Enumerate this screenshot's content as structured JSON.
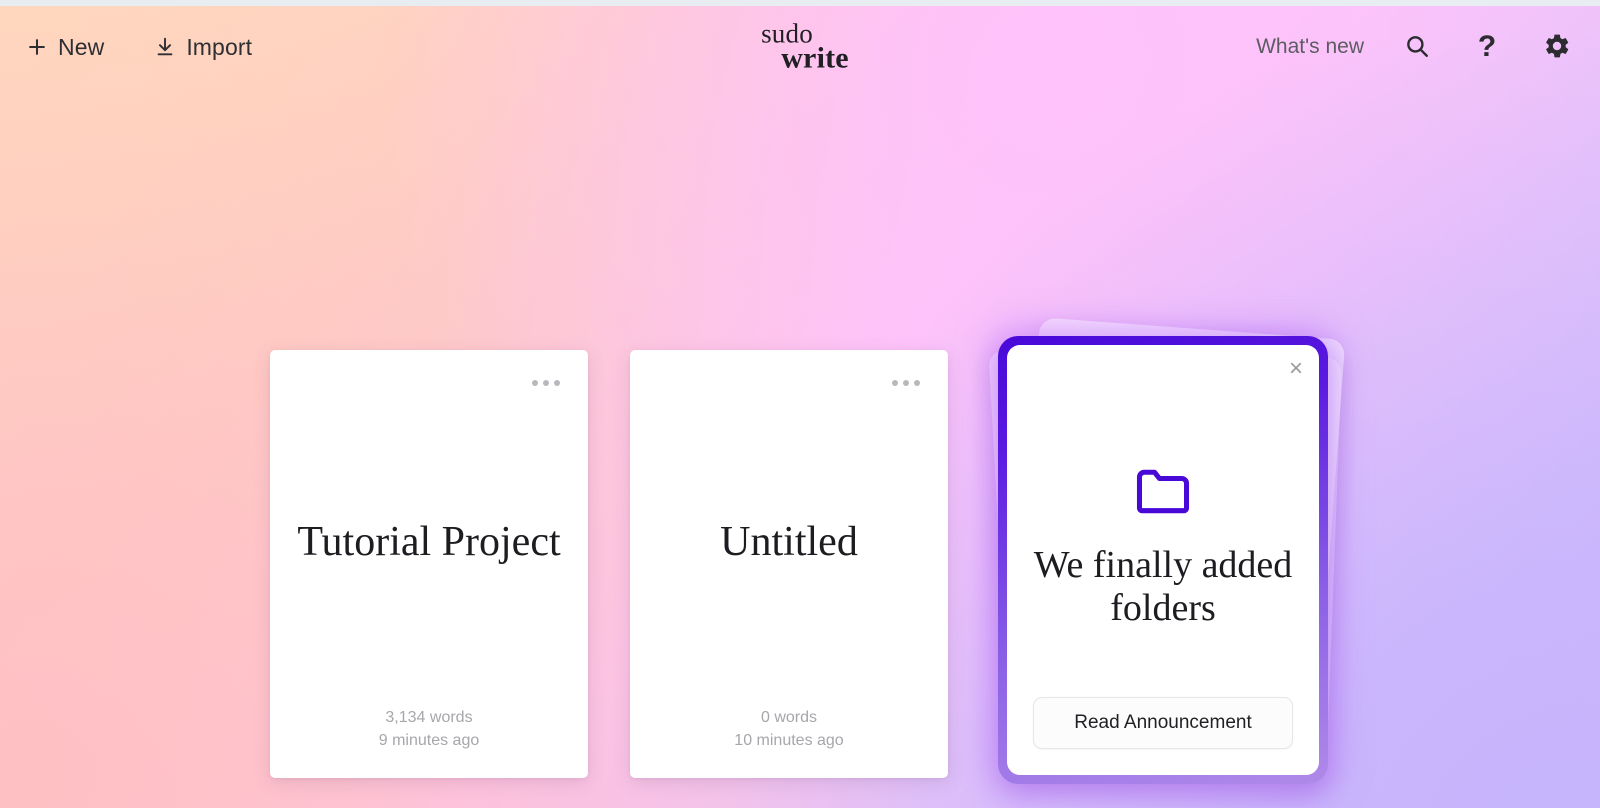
{
  "app": {
    "logo_line1": "sudo",
    "logo_line2": "write",
    "background_colors": {
      "top_left": "#fdd9bb",
      "bottom_left": "#ffc0c4",
      "top_right": "#fcc5f8",
      "bottom_right": "#c9b6fb",
      "center_pink": "#ffc2fb"
    }
  },
  "header": {
    "new_label": "New",
    "import_label": "Import",
    "whats_new_label": "What's new",
    "new_icon": "plus-icon",
    "import_icon": "download-icon",
    "search_icon": "search-icon",
    "help_icon": "question-mark-icon",
    "settings_icon": "gear-icon"
  },
  "projects": [
    {
      "title": "Tutorial Project",
      "words": "3,134 words",
      "modified": "9 minutes ago",
      "menu_icon": "more-options-icon"
    },
    {
      "title": "Untitled",
      "words": "0 words",
      "modified": "10 minutes ago",
      "menu_icon": "more-options-icon"
    }
  ],
  "announcement": {
    "title": "We finally added folders",
    "button_label": "Read Announcement",
    "close_icon": "close-icon",
    "feature_icon": "folder-icon",
    "accent_color": "#4808d8",
    "border_gradient_start": "#4808d8",
    "border_gradient_end": "#b08ae9",
    "close_glyph": "×"
  }
}
